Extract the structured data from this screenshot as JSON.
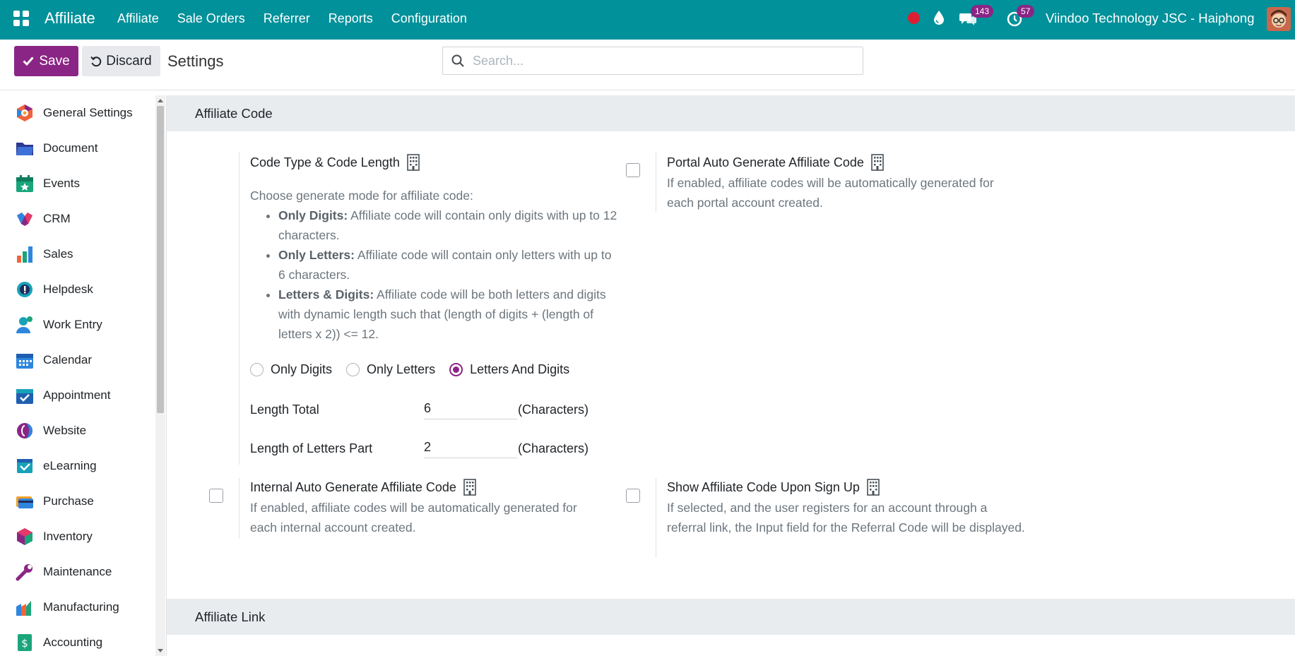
{
  "navbar": {
    "brand": "Affiliate",
    "menu": [
      "Affiliate",
      "Sale Orders",
      "Referrer",
      "Reports",
      "Configuration"
    ],
    "messages_count": "143",
    "activities_count": "57",
    "company": "Viindoo Technology JSC - Haiphong"
  },
  "control": {
    "save_label": "Save",
    "discard_label": "Discard",
    "title": "Settings",
    "search_placeholder": "Search..."
  },
  "sidebar": {
    "items": [
      {
        "label": "General Settings",
        "icon": "general-settings-icon"
      },
      {
        "label": "Document",
        "icon": "folder-icon"
      },
      {
        "label": "Events",
        "icon": "calendar-star-icon"
      },
      {
        "label": "CRM",
        "icon": "crm-icon"
      },
      {
        "label": "Sales",
        "icon": "sales-chart-icon"
      },
      {
        "label": "Helpdesk",
        "icon": "helpdesk-icon"
      },
      {
        "label": "Work Entry",
        "icon": "person-clock-icon"
      },
      {
        "label": "Calendar",
        "icon": "calendar-icon"
      },
      {
        "label": "Appointment",
        "icon": "appointment-icon"
      },
      {
        "label": "Website",
        "icon": "website-icon"
      },
      {
        "label": "eLearning",
        "icon": "elearning-icon"
      },
      {
        "label": "Purchase",
        "icon": "credit-card-icon"
      },
      {
        "label": "Inventory",
        "icon": "box-icon"
      },
      {
        "label": "Maintenance",
        "icon": "wrench-icon"
      },
      {
        "label": "Manufacturing",
        "icon": "factory-icon"
      },
      {
        "label": "Accounting",
        "icon": "accounting-icon"
      }
    ]
  },
  "sections": {
    "affiliate_code": "Affiliate Code",
    "affiliate_link": "Affiliate Link"
  },
  "code_type": {
    "title": "Code Type & Code Length",
    "intro": "Choose generate mode for affiliate code:",
    "modes": [
      {
        "name": "Only Digits:",
        "desc": " Affiliate code will contain only digits with up to 12 characters."
      },
      {
        "name": "Only Letters:",
        "desc": " Affiliate code will contain only letters with up to 6 characters."
      },
      {
        "name": "Letters & Digits:",
        "desc": " Affiliate code will be both letters and digits with dynamic length such that (length of digits + (length of letters x 2)) <= 12."
      }
    ],
    "radio_only_digits": "Only Digits",
    "radio_only_letters": "Only Letters",
    "radio_letters_digits": "Letters And Digits",
    "selected": "Letters And Digits",
    "length_total_label": "Length Total",
    "length_total_value": "6",
    "letters_part_label": "Length of Letters Part",
    "letters_part_value": "2",
    "unit": "(Characters)"
  },
  "portal_auto": {
    "title": "Portal Auto Generate Affiliate Code",
    "desc": "If enabled, affiliate codes will be automatically generated for each portal account created.",
    "checked": false
  },
  "internal_auto": {
    "title": "Internal Auto Generate Affiliate Code",
    "desc": "If enabled, affiliate codes will be automatically generated for each internal account created.",
    "checked": false
  },
  "show_code": {
    "title": "Show Affiliate Code Upon Sign Up",
    "desc": "If selected, and the user registers for an account through a referral link, the Input field for the Referral Code will be displayed.",
    "checked": false
  },
  "colors": {
    "navbar": "#00919a",
    "primary": "#8b2585",
    "section_bg": "#e9ecef"
  }
}
